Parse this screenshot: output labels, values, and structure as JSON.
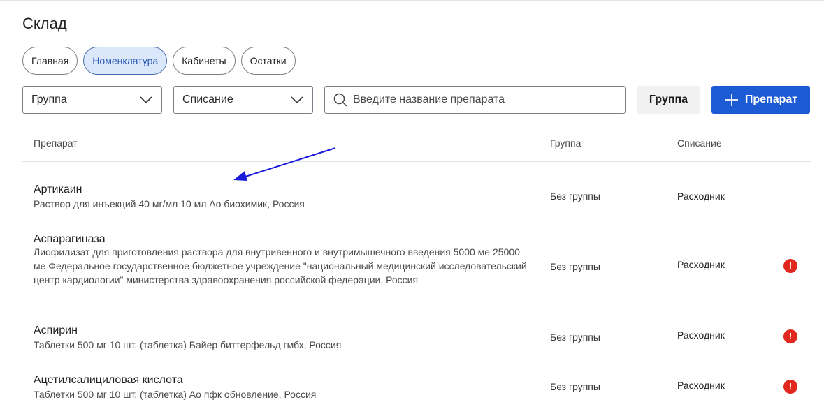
{
  "page": {
    "title": "Склад"
  },
  "tabs": [
    {
      "label": "Главная",
      "active": false
    },
    {
      "label": "Номенклатура",
      "active": true
    },
    {
      "label": "Кабинеты",
      "active": false
    },
    {
      "label": "Остатки",
      "active": false
    }
  ],
  "filters": {
    "group_select": {
      "value": "Группа"
    },
    "writeoff_select": {
      "value": "Списание"
    },
    "search": {
      "placeholder": "Введите название препарата",
      "value": ""
    },
    "group_button_label": "Группа",
    "add_button_label": "Препарат"
  },
  "table": {
    "headers": {
      "drug": "Препарат",
      "group": "Группа",
      "writeoff": "Списание"
    },
    "rows": [
      {
        "name": "Артикаин",
        "description": "Раствор для инъекций 40 мг/мл 10 мл Ао биохимик, Россия",
        "group": "Без группы",
        "writeoff": "Расходник",
        "warning": false
      },
      {
        "name": "Аспарагиназа",
        "description": "Лиофилизат для приготовления раствора для внутривенного и внутримышечного введения 5000 ме 25000 ме Федеральное государственное бюджетное учреждение \"национальный медицинский исследовательский центр кардиологии\" министерства здравоохранения российской федерации, Россия",
        "group": "Без группы",
        "writeoff": "Расходник",
        "warning": true
      },
      {
        "name": "Аспирин",
        "description": "Таблетки 500 мг 10 шт. (таблетка) Байер биттерфельд гмбх, Россия",
        "group": "Без группы",
        "writeoff": "Расходник",
        "warning": true
      },
      {
        "name": "Ацетилсалициловая кислота",
        "description": "Таблетки 500 мг 10 шт. (таблетка) Ао пфк обновление, Россия",
        "group": "Без группы",
        "writeoff": "Расходник",
        "warning": true
      }
    ]
  },
  "icons": {
    "chevron": "chevron-down-icon",
    "search": "search-icon",
    "plus": "plus-icon",
    "warning": "warning-icon",
    "warning_glyph": "!"
  },
  "colors": {
    "primary": "#1d5bd4",
    "active_tab_bg": "#dbe7fb",
    "warning": "#e0281e",
    "annotation_arrow": "#1a1adb"
  }
}
